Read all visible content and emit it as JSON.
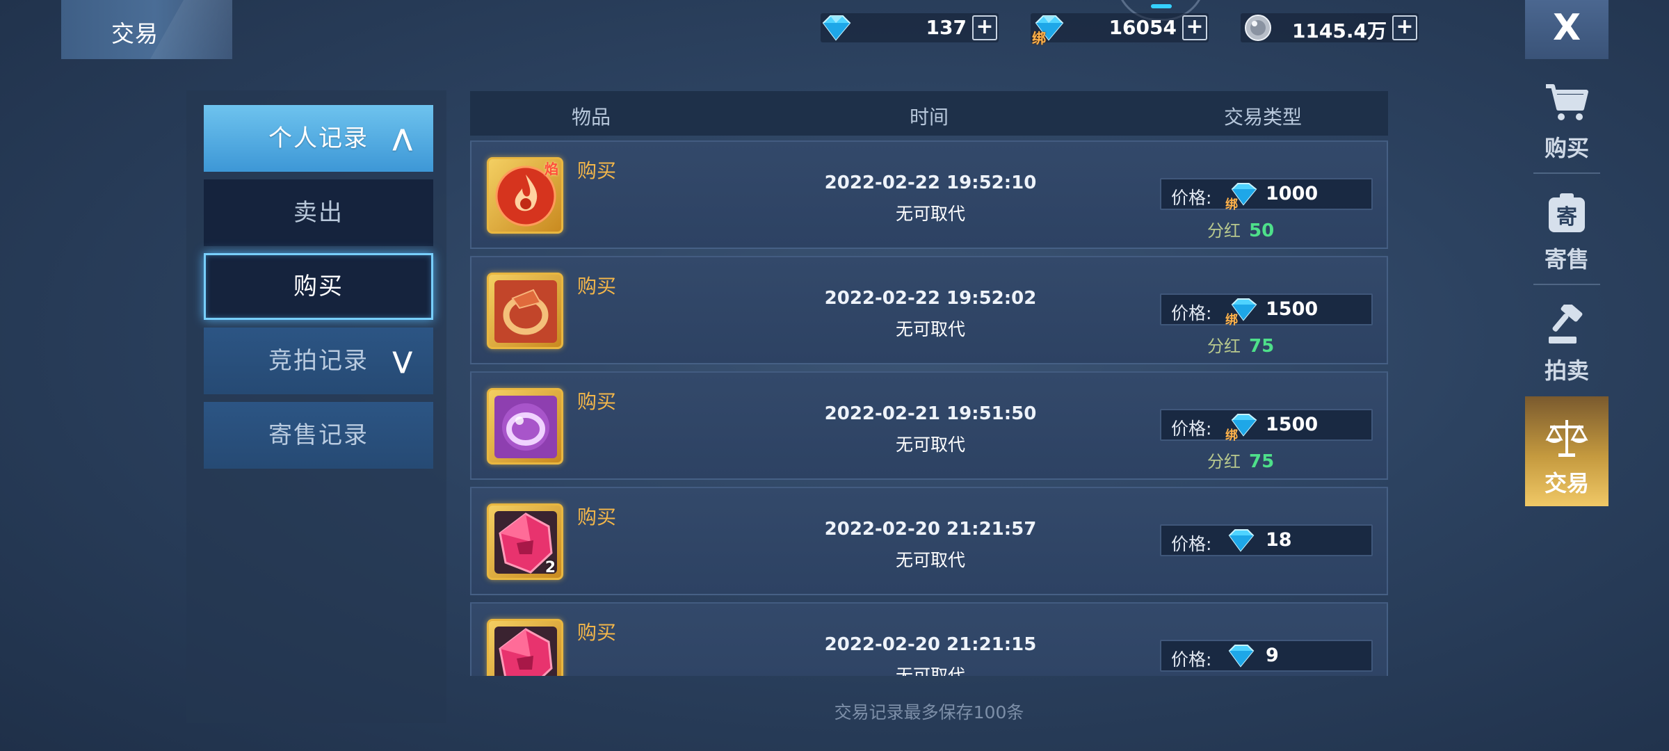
{
  "header": {
    "title": "交易",
    "close_label": "X"
  },
  "currencies": [
    {
      "name": "diamond",
      "icon": "diamond-icon",
      "value": "137",
      "plus": "+"
    },
    {
      "name": "bound-diamond",
      "icon": "bound-diamond-icon",
      "badge": "绑",
      "value": "16054",
      "plus": "+"
    },
    {
      "name": "silver-coin",
      "icon": "silver-coin-icon",
      "value": "1145.4万",
      "plus": "+"
    }
  ],
  "left_menu": {
    "personal": {
      "label": "个人记录",
      "arrow": "⋀"
    },
    "sell": {
      "label": "卖出"
    },
    "buy": {
      "label": "购买"
    },
    "auction": {
      "label": "竞拍记录",
      "arrow": "⋁"
    },
    "consign": {
      "label": "寄售记录"
    }
  },
  "table": {
    "headers": {
      "item": "物品",
      "time": "时间",
      "type": "交易类型"
    },
    "price_label": "价格:",
    "bonus_label": "分红",
    "bound_badge": "绑",
    "rows": [
      {
        "type": "购买",
        "time": "2022-02-22 19:52:10",
        "name": "无可取代",
        "price": "1000",
        "bound": true,
        "bonus": "50",
        "icon": "fire-emblem-icon",
        "badge": "焰",
        "count": ""
      },
      {
        "type": "购买",
        "time": "2022-02-22 19:52:02",
        "name": "无可取代",
        "price": "1500",
        "bound": true,
        "bonus": "75",
        "icon": "red-ring-icon",
        "badge": "",
        "count": ""
      },
      {
        "type": "购买",
        "time": "2022-02-21 19:51:50",
        "name": "无可取代",
        "price": "1500",
        "bound": true,
        "bonus": "75",
        "icon": "purple-ring-icon",
        "badge": "",
        "count": ""
      },
      {
        "type": "购买",
        "time": "2022-02-20 21:21:57",
        "name": "无可取代",
        "price": "18",
        "bound": false,
        "bonus": "",
        "icon": "pink-gem-icon",
        "badge": "",
        "count": "2"
      },
      {
        "type": "购买",
        "time": "2022-02-20 21:21:15",
        "name": "无可取代",
        "price": "9",
        "bound": false,
        "bonus": "",
        "icon": "pink-gem-icon",
        "badge": "",
        "count": ""
      }
    ]
  },
  "footer": {
    "note": "交易记录最多保存100条"
  },
  "side_nav": [
    {
      "label": "购买",
      "icon": "cart-icon",
      "active": false
    },
    {
      "label": "寄售",
      "icon": "consign-icon",
      "active": false
    },
    {
      "label": "拍卖",
      "icon": "gavel-icon",
      "active": false
    },
    {
      "label": "交易",
      "icon": "scales-icon",
      "active": true
    }
  ],
  "colors": {
    "accent_blue": "#3d97d6",
    "item_type": "#f3b64a",
    "bonus_value": "#4ee08a",
    "active_nav": "#c59a3f"
  }
}
